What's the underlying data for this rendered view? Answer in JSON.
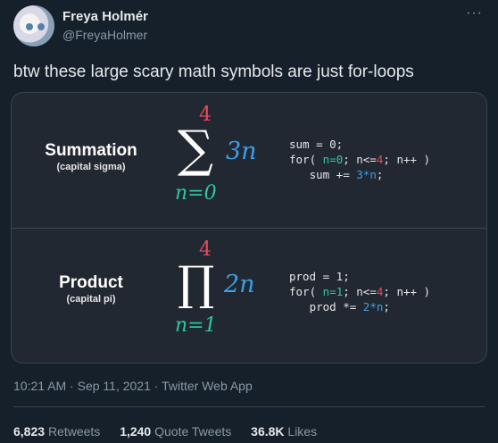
{
  "author": {
    "name": "Freya Holmér",
    "handle": "@FreyaHolmer"
  },
  "tweet_text": "btw these large scary math symbols are just for-loops",
  "image": {
    "summation": {
      "title": "Summation",
      "subtitle": "(capital sigma)",
      "upper": "4",
      "symbol": "∑",
      "term": "3n",
      "lower": "n=0",
      "code": {
        "l1": "sum = 0;",
        "l2_a": "for( ",
        "l2_init": "n=0",
        "l2_b": "; n<=",
        "l2_lim": "4",
        "l2_c": "; n++ )",
        "l3_a": "   sum += ",
        "l3_expr": "3*n",
        "l3_b": ";"
      }
    },
    "product": {
      "title": "Product",
      "subtitle": "(capital pi)",
      "upper": "4",
      "symbol": "∏",
      "term": "2n",
      "lower": "n=1",
      "code": {
        "l1": "prod = 1;",
        "l2_a": "for( ",
        "l2_init": "n=1",
        "l2_b": "; n<=",
        "l2_lim": "4",
        "l2_c": "; n++ )",
        "l3_a": "   prod *= ",
        "l3_expr": "2*n",
        "l3_b": ";"
      }
    }
  },
  "meta": {
    "time": "10:21 AM",
    "dot": "·",
    "date": "Sep 11, 2021",
    "source": "Twitter Web App"
  },
  "stats": {
    "retweets_count": "6,823",
    "retweets_label": "Retweets",
    "quotes_count": "1,240",
    "quotes_label": "Quote Tweets",
    "likes_count": "36.8K",
    "likes_label": "Likes"
  },
  "icons": {
    "more": "more-icon"
  },
  "colors": {
    "background": "#15202b",
    "red": "#e84a5f",
    "green": "#2fc7a1",
    "blue": "#3a9fe8"
  }
}
